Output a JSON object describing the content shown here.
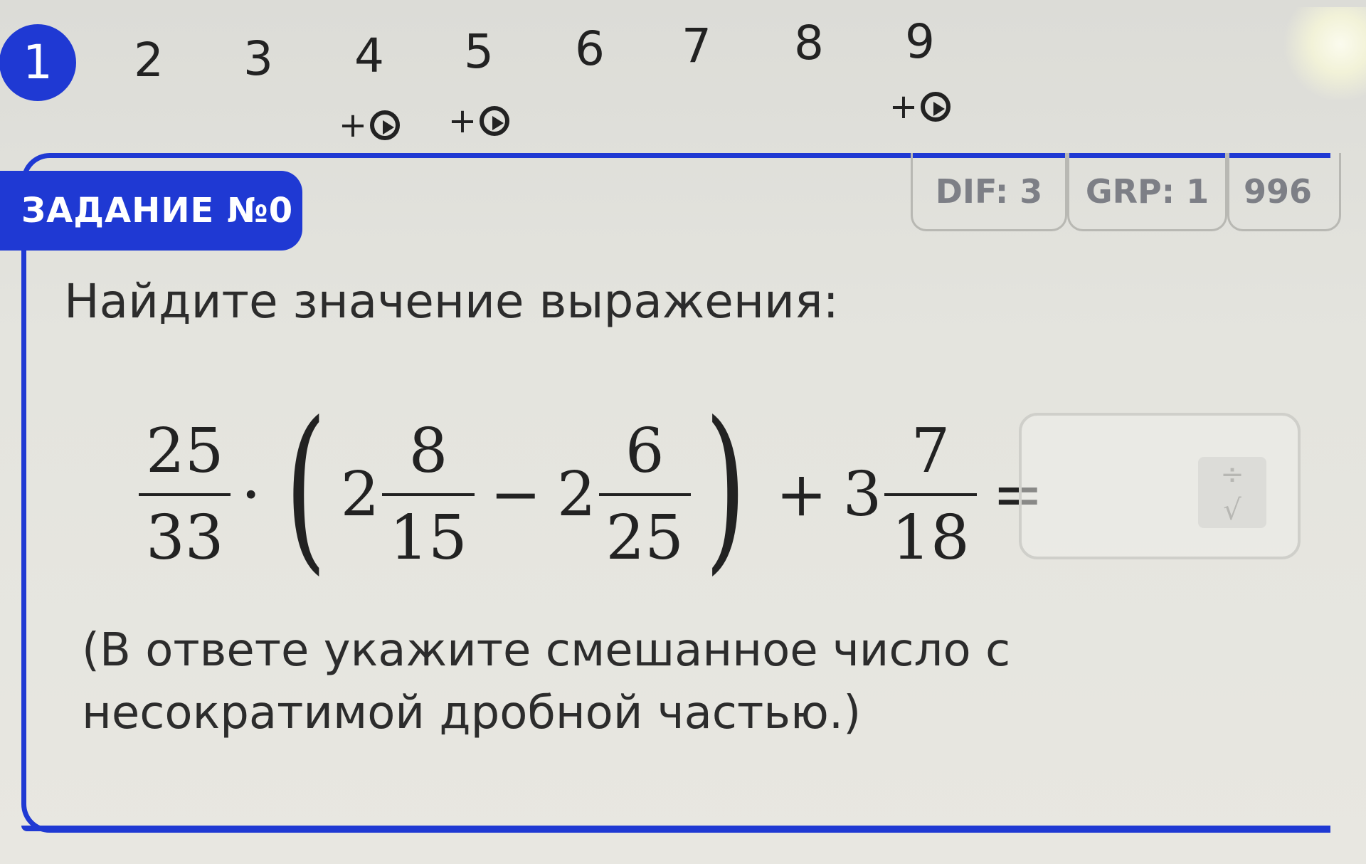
{
  "nav": {
    "items": [
      {
        "number": "1",
        "active": true,
        "extra": ""
      },
      {
        "number": "2",
        "active": false,
        "extra": ""
      },
      {
        "number": "3",
        "active": false,
        "extra": ""
      },
      {
        "number": "4",
        "active": false,
        "extra": "+"
      },
      {
        "number": "5",
        "active": false,
        "extra": "+"
      },
      {
        "number": "6",
        "active": false,
        "extra": ""
      },
      {
        "number": "7",
        "active": false,
        "extra": ""
      },
      {
        "number": "8",
        "active": false,
        "extra": ""
      },
      {
        "number": "9",
        "active": false,
        "extra": "+"
      }
    ],
    "play_icon": "play-circle-icon"
  },
  "task": {
    "badge": "ЗАДАНИЕ №0",
    "tags": {
      "dif": "DIF: 3",
      "grp": "GRP: 1",
      "id": "996"
    },
    "question": "Найдите значение выражения:",
    "expression": {
      "f1": {
        "num": "25",
        "den": "33"
      },
      "dot": "·",
      "lparen": "(",
      "m1": {
        "whole": "2",
        "num": "8",
        "den": "15"
      },
      "minus": "−",
      "m2": {
        "whole": "2",
        "num": "6",
        "den": "25"
      },
      "rparen": ")",
      "plus": "+",
      "m3": {
        "whole": "3",
        "num": "7",
        "den": "18"
      },
      "equals": "="
    },
    "answer_value": "",
    "formula_button": {
      "top": "÷",
      "bottom": "√"
    },
    "note": "(В ответе укажите смешанное число с несократимой дробной частью.)"
  },
  "colors": {
    "accent": "#1f39d3",
    "tag_text": "#7d7f86"
  }
}
